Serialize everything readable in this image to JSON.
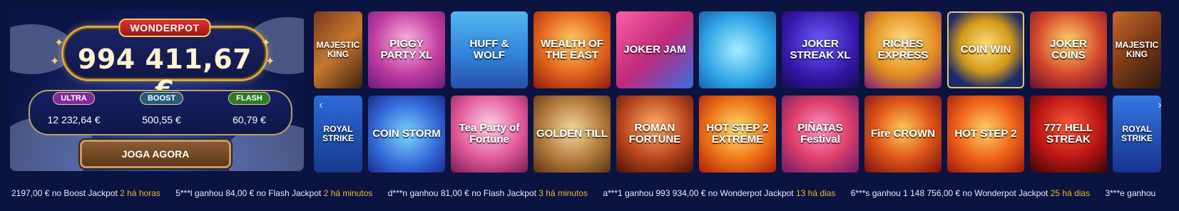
{
  "jackpot": {
    "title": "WONDERPOT",
    "amount": "994 411,67 €",
    "tiers": [
      {
        "label": "ULTRA",
        "value": "12 232,64 €"
      },
      {
        "label": "BOOST",
        "value": "500,55 €"
      },
      {
        "label": "FLASH",
        "value": "60,79 €"
      }
    ],
    "play_label": "JOGA AGORA"
  },
  "games": {
    "row1": [
      {
        "title": "MAJESTIC KING"
      },
      {
        "title": "PIGGY PARTY XL"
      },
      {
        "title": "HUFF & WOLF"
      },
      {
        "title": "WEALTH OF THE EAST"
      },
      {
        "title": "JOKER JAM"
      },
      {
        "title": ""
      },
      {
        "title": "JOKER STREAK XL"
      },
      {
        "title": "RICHES EXPRESS"
      },
      {
        "title": "COIN WIN"
      },
      {
        "title": "JOKER COINS"
      },
      {
        "title": "MAJESTIC KING"
      }
    ],
    "row2": [
      {
        "title": "ROYAL STRIKE"
      },
      {
        "title": "COIN STORM"
      },
      {
        "title": "Tea Party of Fortune"
      },
      {
        "title": "GOLDEN TILL"
      },
      {
        "title": "ROMAN FORTUNE"
      },
      {
        "title": "HOT STEP 2 EXTREME"
      },
      {
        "title": "PIÑATAS Festival"
      },
      {
        "title": "Fire CROWN"
      },
      {
        "title": "HOT STEP 2"
      },
      {
        "title": "777 HELL STREAK"
      },
      {
        "title": "ROYAL STRIKE"
      }
    ]
  },
  "ticker": [
    {
      "text": "2197,00 € no Boost Jackpot",
      "ago": "2 há horas"
    },
    {
      "text": "5***l ganhou 84,00 € no Flash Jackpot",
      "ago": "2 há minutos"
    },
    {
      "text": "d***n ganhou 81,00 € no Flash Jackpot",
      "ago": "3 há minutos"
    },
    {
      "text": "a***1 ganhou 993 934,00 € no Wonderpot Jackpot",
      "ago": "13 há dias"
    },
    {
      "text": "6***s ganhou 1 148 756,00 € no Wonderpot Jackpot",
      "ago": "25 há dias"
    },
    {
      "text": "3***e ganhou",
      "ago": ""
    }
  ],
  "colors": {
    "page_bg": "#0b1340",
    "gold_accent": "#d4a94f",
    "ticker_time": "#f0b63a"
  },
  "icons": [
    "star-icon",
    "chevron-left-icon",
    "chevron-right-icon"
  ]
}
